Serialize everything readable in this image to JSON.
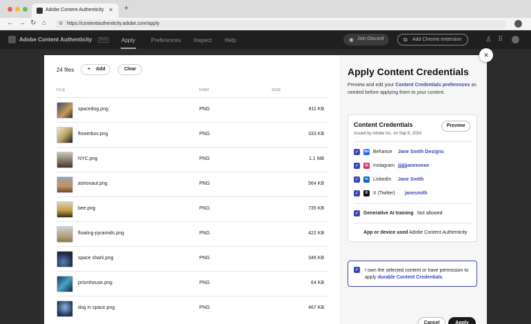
{
  "browser": {
    "tab_title": "Adobe Content Authenticity",
    "tab_close": "✕",
    "new_tab": "+",
    "url": "https://contentauthenticity.adobe.com/apply"
  },
  "app": {
    "name": "Adobe Content Authenticity",
    "badge": "Beta",
    "nav": [
      "Apply",
      "Preferences",
      "Inspect",
      "Help"
    ],
    "join_discord": "Join Discord",
    "add_extension": "Add Chrome extension"
  },
  "files": {
    "count_label": "24 files",
    "add_label": "Add",
    "clear_label": "Clear",
    "col_file": "FILE",
    "col_kind": "KIND",
    "col_size": "SIZE",
    "rows": [
      {
        "name": "spacedog.png",
        "kind": "PNG",
        "size": "911 KB"
      },
      {
        "name": "flowerbox.png",
        "kind": "PNG",
        "size": "333 KB"
      },
      {
        "name": "NYC.png",
        "kind": "PNG",
        "size": "1.1 MB"
      },
      {
        "name": "astronaut.png",
        "kind": "PNG",
        "size": "564 KB"
      },
      {
        "name": "bee.png",
        "kind": "PNG",
        "size": "735 KB"
      },
      {
        "name": "floating-pyramids.png",
        "kind": "PNG",
        "size": "422 KB"
      },
      {
        "name": "space shark.png",
        "kind": "PNG",
        "size": "346 KB"
      },
      {
        "name": "prismhouse.png",
        "kind": "PNG",
        "size": "64 KB"
      },
      {
        "name": "dog in space.png",
        "kind": "PNG",
        "size": "467 KB"
      }
    ]
  },
  "panel": {
    "title": "Apply Content Credentials",
    "desc_pre": "Preview and edit your ",
    "desc_link": "Content Credentials preferences",
    "desc_post": " as needed before applying them to your content.",
    "card_title": "Content Credentials",
    "card_sub": "Issued by Adobe Inc. on Sep 8, 2024",
    "preview_label": "Preview",
    "socials": [
      {
        "site": "Behance",
        "account": "Jane Smith Designs",
        "icon": "Bē",
        "color": "#1769ff"
      },
      {
        "site": "Instagram",
        "account": "jjjjjjjaneeeeee",
        "icon": "◎",
        "color": "#d6336c"
      },
      {
        "site": "LinkedIn",
        "account": "Jane Smith",
        "icon": "in",
        "color": "#0a66c2"
      },
      {
        "site": "X (Twitter)",
        "account": "janesmith",
        "icon": "X",
        "color": "#111111"
      }
    ],
    "ai_label": "Generative AI training",
    "ai_value": "Not allowed",
    "device_label": "App or device used",
    "device_value": "Adobe Content Authenticity",
    "own_pre": "I own the selected content or have permission to apply ",
    "own_link": "durable Content Credentials",
    "own_post": ".",
    "cancel_label": "Cancel",
    "apply_label": "Apply"
  },
  "colors": {
    "accent": "#3a45b5"
  }
}
